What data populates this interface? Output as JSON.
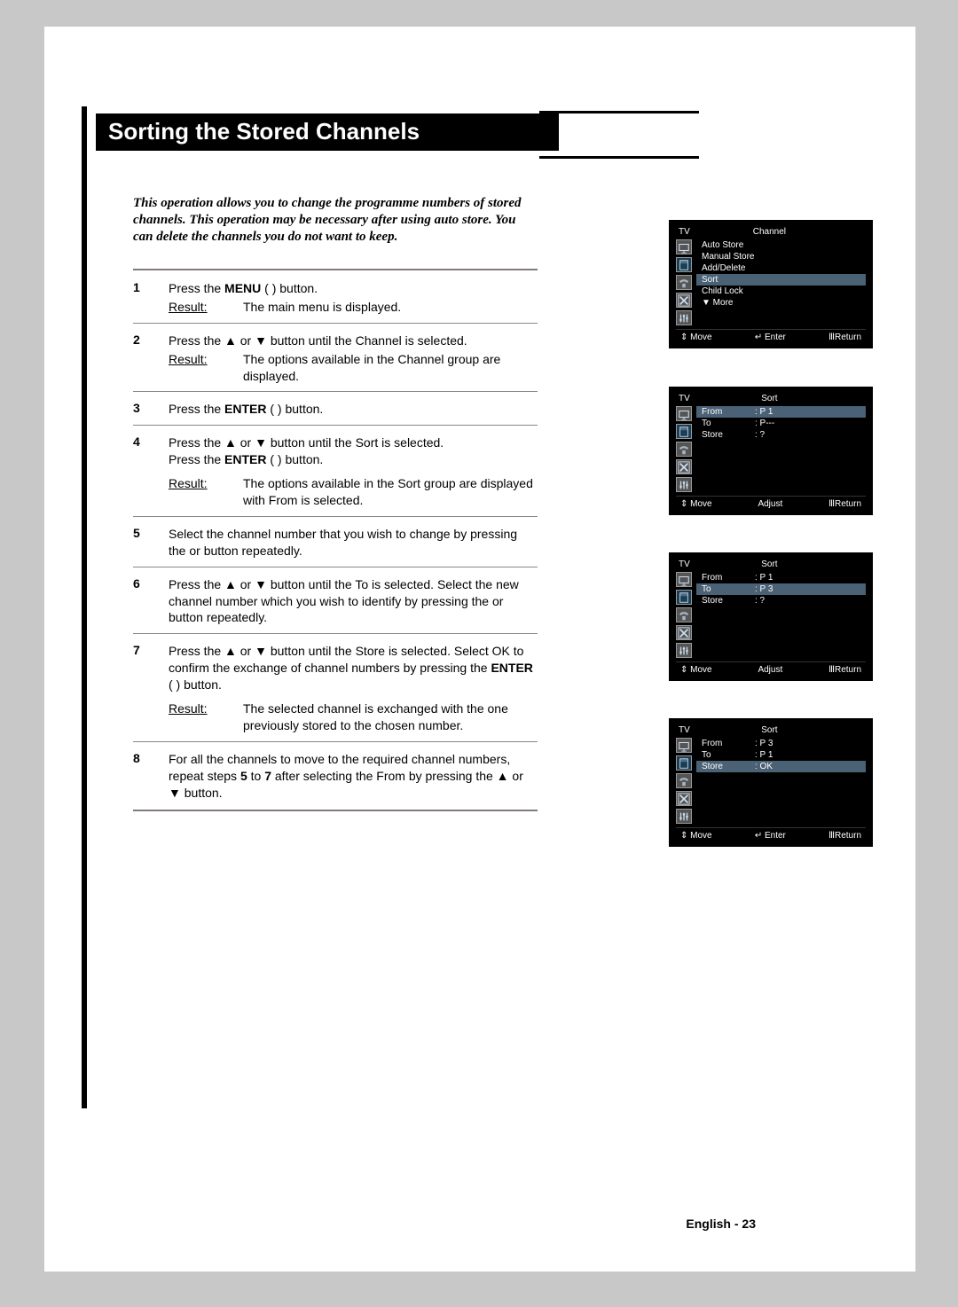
{
  "title": "Sorting the Stored Channels",
  "intro": "This operation allows you to change the programme numbers of stored channels. This operation may be necessary after using auto store. You can delete the channels you do not want to keep.",
  "steps": [
    {
      "num": "1",
      "parts": {
        "a": "Press the ",
        "menu_bold": "MENU",
        "b": " (        ) button.",
        "result_label": "Result:",
        "result_text": "The main menu is displayed."
      }
    },
    {
      "num": "2",
      "parts": {
        "a": "Press the ▲ or ▼ button until the Channel  is selected.",
        "result_label": "Result:",
        "result_text": "The options available in the Channel  group are displayed."
      }
    },
    {
      "num": "3",
      "parts": {
        "a": "Press the ",
        "enter_bold": "ENTER",
        "b": " (        ) button."
      }
    },
    {
      "num": "4",
      "parts": {
        "a": "Press the ▲ or ▼ button until the Sort  is selected.",
        "b_pre": "Press the ",
        "enter_bold": "ENTER",
        "b_post": " (        ) button.",
        "result_label": "Result:",
        "result_text": "The options available in the Sort  group are displayed with From is selected."
      }
    },
    {
      "num": "5",
      "parts": {
        "a": "Select the channel number that you wish to change by pressing the      or      button repeatedly."
      }
    },
    {
      "num": "6",
      "parts": {
        "a": "Press the ▲ or ▼ button until the To is selected. Select the new channel number which you wish to identify by pressing the      or      button repeatedly."
      }
    },
    {
      "num": "7",
      "parts": {
        "a_pre": "Press the ▲ or ▼ button until the Store  is selected. Select OK to confirm the exchange of channel numbers by pressing the ",
        "enter_bold": "ENTER",
        "a_post": " (        ) button.",
        "result_label": "Result:",
        "result_text": "The selected channel is exchanged with the one previously stored to the chosen number."
      }
    },
    {
      "num": "8",
      "parts": {
        "a_pre": "For all the channels to move to the required channel numbers, repeat steps ",
        "b5": "5",
        "mid": " to ",
        "b7": "7",
        "a_post": " after selecting the From by pressing the ▲ or ▼ button."
      }
    }
  ],
  "footer": "English - 23",
  "osd": {
    "tv": "TV",
    "bar": {
      "move": "Move",
      "enter": "Enter",
      "adjust": "Adjust",
      "return": "Return"
    },
    "s1": {
      "title": "Channel",
      "items": [
        "Auto Store",
        "Manual Store",
        "Add/Delete",
        "Sort",
        "Child Lock",
        "▼ More"
      ],
      "hl_index": 3,
      "mode": "enter"
    },
    "s2": {
      "title": "Sort",
      "rows": [
        {
          "k": "From",
          "v": ":   P  1",
          "hl": true
        },
        {
          "k": "To",
          "v": ":   P---"
        },
        {
          "k": "Store",
          "v": ":   ?"
        }
      ],
      "mode": "adjust"
    },
    "s3": {
      "title": "Sort",
      "rows": [
        {
          "k": "From",
          "v": ":   P  1"
        },
        {
          "k": "To",
          "v": ":   P  3",
          "hl": true
        },
        {
          "k": "Store",
          "v": ":   ?"
        }
      ],
      "mode": "adjust"
    },
    "s4": {
      "title": "Sort",
      "rows": [
        {
          "k": "From",
          "v": ":   P  3"
        },
        {
          "k": "To",
          "v": ":   P  1"
        },
        {
          "k": "Store",
          "v": ":   OK",
          "hl": true
        }
      ],
      "mode": "enter"
    }
  }
}
